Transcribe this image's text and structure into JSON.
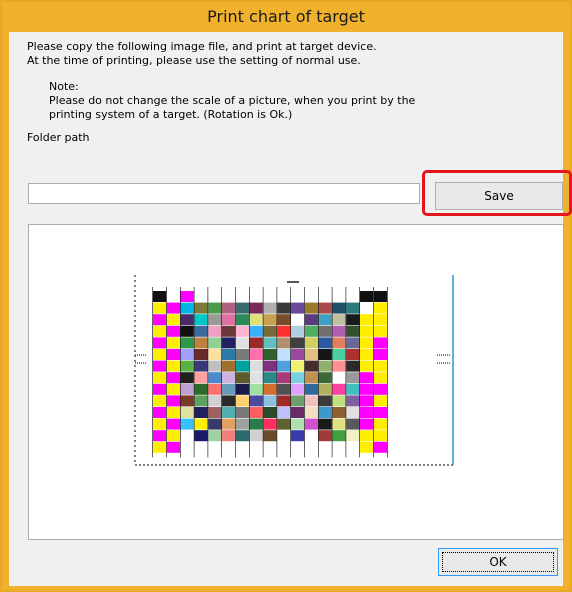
{
  "window": {
    "title": "Print chart of target"
  },
  "instructions": {
    "line1": "Please copy the following image file, and print at target device.",
    "line2": "At the time of printing, please use the setting of normal use."
  },
  "note": {
    "heading": "Note:",
    "line1": "Please do not change the scale of a picture, when you print by the",
    "line2": "printing system of a target. (Rotation is Ok.)"
  },
  "folder": {
    "label": "Folder path",
    "value": "",
    "save_label": "Save"
  },
  "footer": {
    "ok_label": "OK"
  },
  "colors": {
    "title_bar": "#f0b22c",
    "highlight": "#e5161b",
    "dialog_bg": "#f0f0f0"
  },
  "chart_patches": [
    [
      "#111111",
      "#ffffff",
      "#ff00ff",
      "#ffffff",
      "#ffffff",
      "#ffffff",
      "#ffffff",
      "#ffffff",
      "#ffffff",
      "#ffffff",
      "#ffffff",
      "#ffffff",
      "#ffffff",
      "#ffffff",
      "#ffffff",
      "#111111",
      "#111111"
    ],
    [
      "#ffee00",
      "#ff00ff",
      "#00b4e6",
      "#7a7a3a",
      "#4a9a4a",
      "#b06080",
      "#3a6a6a",
      "#7a2a5a",
      "#b0b0b0",
      "#3a3a3a",
      "#6a4a9a",
      "#9a7a2a",
      "#aa4a4a",
      "#20506a",
      "#2a7a7a",
      "#ffffff",
      "#ffee00"
    ],
    [
      "#ff00ff",
      "#ffee00",
      "#4a2a6a",
      "#00c8c8",
      "#9a9a9a",
      "#e070a0",
      "#2a8a5a",
      "#e0e07a",
      "#c8a050",
      "#7a4a2a",
      "#ffffff",
      "#5a3a7a",
      "#40a0c0",
      "#c0c0a0",
      "#1a1a1a",
      "#ffee00",
      "#ffee00"
    ],
    [
      "#ffee00",
      "#ff00ff",
      "#111111",
      "#3a6aa0",
      "#f0a0c0",
      "#6a3a3a",
      "#ffb4d0",
      "#3ab0ff",
      "#7a6a3a",
      "#ff3030",
      "#b0d0e0",
      "#4ab060",
      "#707070",
      "#b060b0",
      "#305030",
      "#ffee00",
      "#ffee00"
    ],
    [
      "#ff00ff",
      "#ffee00",
      "#2a9a4a",
      "#c08040",
      "#90d090",
      "#202060",
      "#e0e0e0",
      "#9a2a2a",
      "#60c0c0",
      "#b09070",
      "#404040",
      "#d0d060",
      "#2a5aa0",
      "#e08060",
      "#6a6a9a",
      "#ffee00",
      "#ff00ff"
    ],
    [
      "#ffee00",
      "#ff00ff",
      "#a0a0ff",
      "#6a2a2a",
      "#ffe0a0",
      "#2a7aaa",
      "#7a7a7a",
      "#ff70b0",
      "#306030",
      "#c0e0ff",
      "#9a4a9a",
      "#e0c080",
      "#151515",
      "#4ad0a0",
      "#b03030",
      "#ffee00",
      "#ff00ff"
    ],
    [
      "#ff00ff",
      "#ffee00",
      "#5ab040",
      "#3a3a7a",
      "#c0c0c0",
      "#a07030",
      "#00a0a0",
      "#dcdcdc",
      "#803080",
      "#50a0e0",
      "#f0f070",
      "#4a2a2a",
      "#90b070",
      "#ff9090",
      "#2a2a2a",
      "#ffee00",
      "#ffee00"
    ],
    [
      "#ffee00",
      "#ff00ff",
      "#202020",
      "#ffa0a0",
      "#4a8aca",
      "#d0b0e0",
      "#5a5a2a",
      "#e0e0e0",
      "#2a8a8a",
      "#aa3a7a",
      "#7ad0e0",
      "#c09050",
      "#3a6a3a",
      "#ffffff",
      "#9a9a9a",
      "#ff00ff",
      "#ffee00"
    ],
    [
      "#ff00ff",
      "#ffee00",
      "#c0a0d0",
      "#2a6a2a",
      "#ff7070",
      "#6a9aba",
      "#1a1a4a",
      "#a0e0a0",
      "#d07030",
      "#505050",
      "#e0a0ff",
      "#306a9a",
      "#b0b060",
      "#ff40a0",
      "#40c0c0",
      "#ff00ff",
      "#ff00ff"
    ],
    [
      "#ffee00",
      "#ff00ff",
      "#7a3a2a",
      "#60a060",
      "#d0d0d0",
      "#2a2a2a",
      "#ffd070",
      "#4a4aa0",
      "#90c0e0",
      "#a02a2a",
      "#6aa06a",
      "#f0c0c0",
      "#3a3a3a",
      "#c0e080",
      "#8060a0",
      "#ff00ff",
      "#ffee00"
    ],
    [
      "#ff00ff",
      "#ffee00",
      "#e0e0a0",
      "#202060",
      "#a06060",
      "#50b0b0",
      "#7a7a7a",
      "#ff6060",
      "#2a4a2a",
      "#c0c0ff",
      "#6a2a6a",
      "#f0e0c0",
      "#3a9ad0",
      "#906030",
      "#e0e0e0",
      "#ff00ff",
      "#ff00ff"
    ],
    [
      "#ffee00",
      "#ff00ff",
      "#3ac0ff",
      "#ffee00",
      "#3a3a6a",
      "#e0a060",
      "#a0a0a0",
      "#2a7a4a",
      "#ff3060",
      "#606030",
      "#b0e0b0",
      "#d050d0",
      "#1a1a1a",
      "#e0e080",
      "#5a5a5a",
      "#ff00ff",
      "#ffee00"
    ],
    [
      "#ff00ff",
      "#ffee00",
      "#ffffff",
      "#1a1a6a",
      "#a0d0a0",
      "#f08080",
      "#2a6a6a",
      "#d0d0d0",
      "#6a4a2a",
      "#ffffff",
      "#3a3aaa",
      "#ffffff",
      "#a03a3a",
      "#40a040",
      "#f0f0c0",
      "#ffee00",
      "#ffee00"
    ],
    [
      "#ffee00",
      "#ff00ff",
      "#ffffff",
      "#ffffff",
      "#ffffff",
      "#ffffff",
      "#ffffff",
      "#ffffff",
      "#ffffff",
      "#ffffff",
      "#ffffff",
      "#ffffff",
      "#ffffff",
      "#ffffff",
      "#ffffff",
      "#ffee00",
      "#ff00ff"
    ]
  ]
}
